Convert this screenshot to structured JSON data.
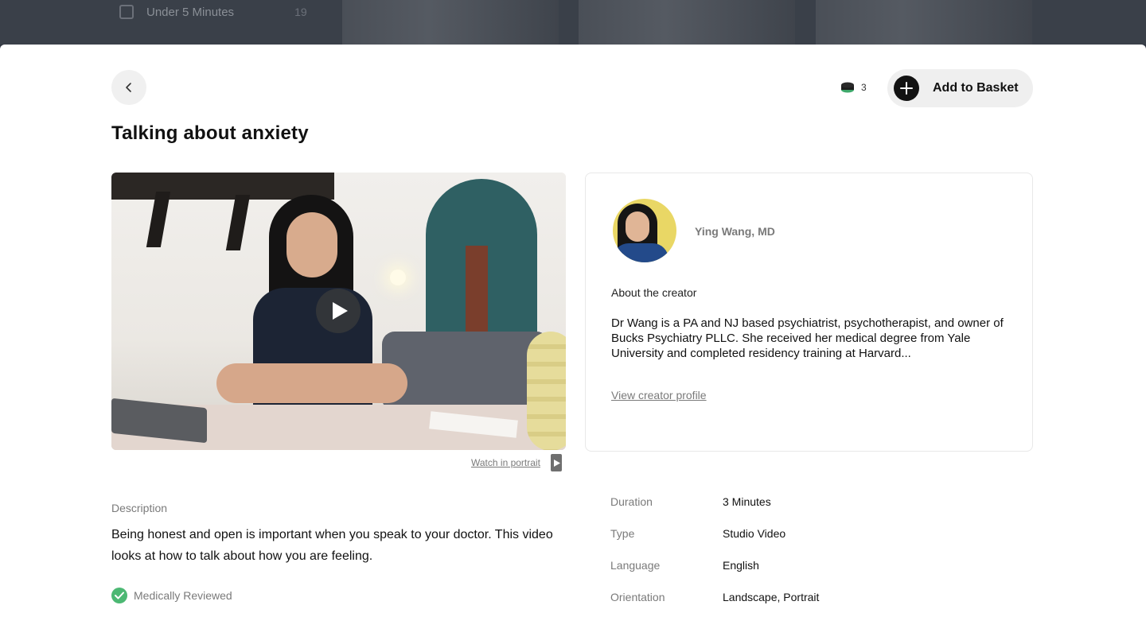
{
  "background": {
    "filter_label": "Under 5 Minutes",
    "filter_count": "19"
  },
  "header": {
    "credits": "3",
    "add_to_basket": "Add to Basket"
  },
  "title": "Talking about anxiety",
  "video": {
    "watch_in_portrait": "Watch in portrait"
  },
  "creator": {
    "name": "Ying Wang, MD",
    "about_label": "About the creator",
    "bio": "Dr Wang is a PA and NJ based psychiatrist, psychotherapist, and owner of Bucks Psychiatry PLLC. She received her medical degree from Yale University and completed residency training at Harvard...",
    "profile_link": "View creator profile"
  },
  "description": {
    "label": "Description",
    "text": "Being honest and open is important when you speak to your doctor. This video looks at how to talk about how you are feeling.",
    "medically_reviewed": "Medically Reviewed"
  },
  "meta": [
    {
      "key": "Duration",
      "value": "3 Minutes"
    },
    {
      "key": "Type",
      "value": "Studio Video"
    },
    {
      "key": "Language",
      "value": "English"
    },
    {
      "key": "Orientation",
      "value": "Landscape, Portrait"
    }
  ],
  "colors": {
    "accent_dark": "#121212",
    "check_green": "#4cb873",
    "muted_text": "#7a7a7a"
  },
  "icons": [
    "chevron-left-icon",
    "coin-stack-icon",
    "plus-icon",
    "play-icon",
    "check-icon"
  ]
}
